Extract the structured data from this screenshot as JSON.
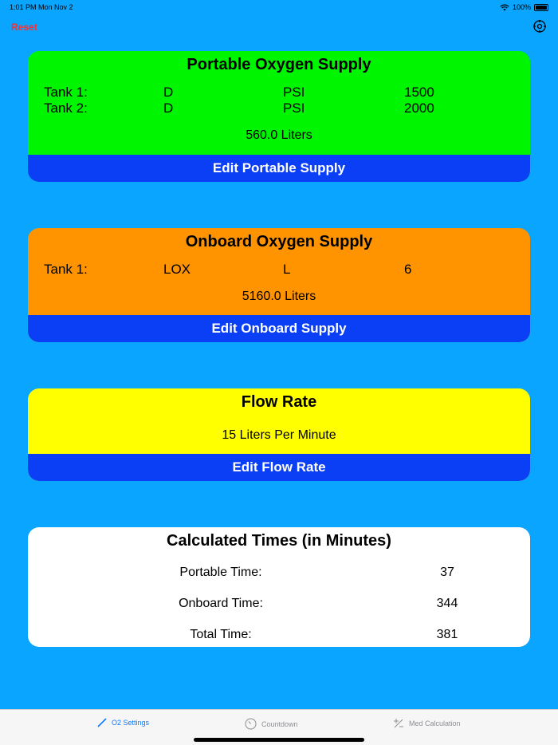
{
  "status": {
    "time": "1:01 PM",
    "date": "Mon Nov 2",
    "battery": "100%"
  },
  "nav": {
    "reset_label": "Reset"
  },
  "portable": {
    "title": "Portable Oxygen Supply",
    "tanks": [
      {
        "label": "Tank 1:",
        "size": "D",
        "unit": "PSI",
        "value": "1500"
      },
      {
        "label": "Tank 2:",
        "size": "D",
        "unit": "PSI",
        "value": "2000"
      }
    ],
    "total": "560.0 Liters",
    "edit_label": "Edit Portable Supply",
    "color": "#00f500"
  },
  "onboard": {
    "title": "Onboard Oxygen Supply",
    "tanks": [
      {
        "label": "Tank 1:",
        "size": "LOX",
        "unit": "L",
        "value": "6"
      }
    ],
    "total": "5160.0 Liters",
    "edit_label": "Edit Onboard Supply",
    "color": "#ff9400"
  },
  "flow": {
    "title": "Flow Rate",
    "value": "15 Liters Per Minute",
    "edit_label": "Edit Flow Rate",
    "color": "#ffff00"
  },
  "calc": {
    "title": "Calculated Times (in Minutes)",
    "rows": [
      {
        "label": "Portable Time:",
        "value": "37"
      },
      {
        "label": "Onboard Time:",
        "value": "344"
      },
      {
        "label": "Total Time:",
        "value": "381"
      }
    ]
  },
  "tabs": [
    {
      "label": "O2 Settings",
      "icon": "pencil-icon",
      "active": true
    },
    {
      "label": "Countdown",
      "icon": "timer-icon",
      "active": false
    },
    {
      "label": "Med Calculation",
      "icon": "plus-minus-icon",
      "active": false
    }
  ],
  "colors": {
    "background": "#0aa5ff",
    "button": "#0b3ff5",
    "reset": "#ff2d2d",
    "active_tab": "#0a7aff"
  }
}
